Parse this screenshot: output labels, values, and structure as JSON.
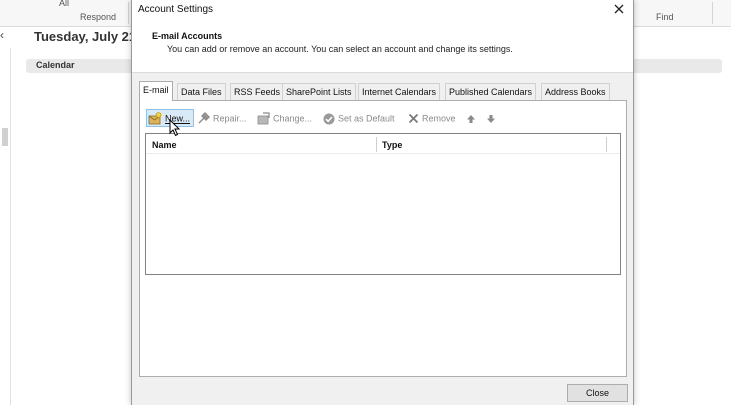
{
  "background": {
    "ribbon_labels": [
      "All",
      "Respond",
      "Find"
    ],
    "date_heading": "Tuesday, July 21,",
    "calendar_label": "Calendar"
  },
  "dialog": {
    "title": "Account Settings",
    "header_title": "E-mail Accounts",
    "header_description": "You can add or remove an account. You can select an account and change its settings.",
    "tabs": [
      {
        "label": "E-mail",
        "active": true
      },
      {
        "label": "Data Files"
      },
      {
        "label": "RSS Feeds"
      },
      {
        "label": "SharePoint Lists"
      },
      {
        "label": "Internet Calendars"
      },
      {
        "label": "Published Calendars"
      },
      {
        "label": "Address Books"
      }
    ],
    "toolbar": {
      "new": "New...",
      "repair": "Repair...",
      "change": "Change...",
      "set_default": "Set as Default",
      "remove": "Remove"
    },
    "list_columns": [
      "Name",
      "Type"
    ],
    "close_button": "Close"
  },
  "icons": {
    "close": "close-icon",
    "new": "new-account-icon",
    "repair": "repair-icon",
    "change": "change-icon",
    "set_default": "checkmark-icon",
    "remove": "remove-icon",
    "move_up": "arrow-up-icon",
    "move_down": "arrow-down-icon"
  },
  "colors": {
    "dialog_bg": "#f0f0f0",
    "hover_bg": "#d8e9f8",
    "hover_border": "#8ec1ea"
  }
}
